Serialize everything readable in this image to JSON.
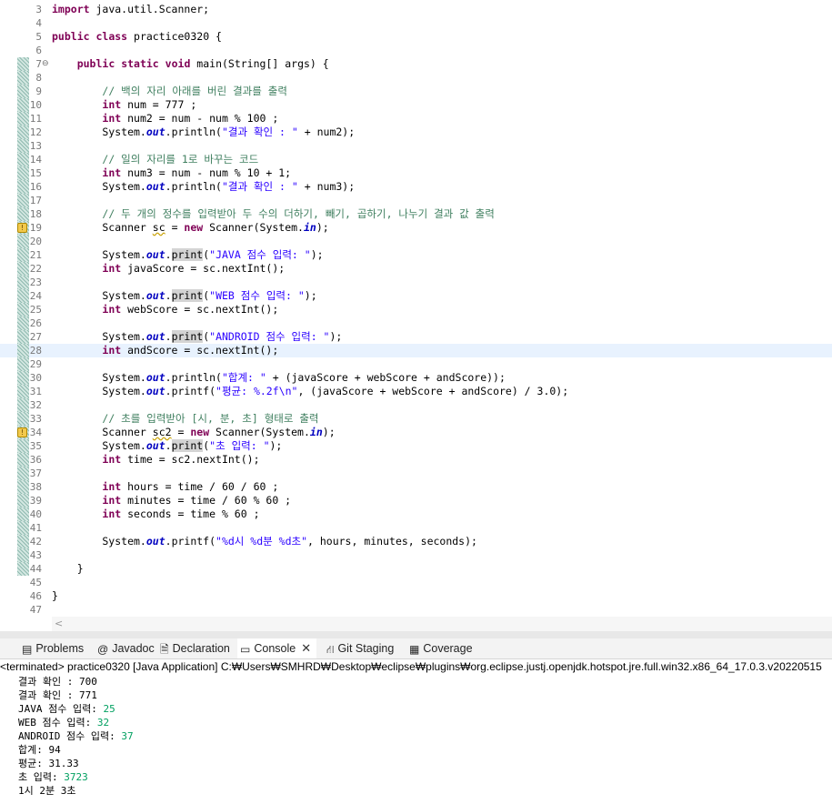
{
  "editor": {
    "lines": [
      {
        "n": "3",
        "segs": [
          {
            "c": "kw",
            "t": "import"
          },
          {
            "t": " java.util.Scanner;"
          }
        ]
      },
      {
        "n": "4",
        "segs": []
      },
      {
        "n": "5",
        "segs": [
          {
            "c": "kw",
            "t": "public"
          },
          {
            "t": " "
          },
          {
            "c": "kw",
            "t": "class"
          },
          {
            "t": " practice0320 {"
          }
        ]
      },
      {
        "n": "6",
        "segs": []
      },
      {
        "n": "7",
        "fold": "⊖",
        "ruler": true,
        "segs": [
          {
            "t": "    "
          },
          {
            "c": "kw",
            "t": "public"
          },
          {
            "t": " "
          },
          {
            "c": "kw",
            "t": "static"
          },
          {
            "t": " "
          },
          {
            "c": "kw",
            "t": "void"
          },
          {
            "t": " main(String[] args) {"
          }
        ]
      },
      {
        "n": "8",
        "ruler": true,
        "segs": []
      },
      {
        "n": "9",
        "ruler": true,
        "segs": [
          {
            "t": "        "
          },
          {
            "c": "cm",
            "t": "// 백의 자리 아래를 버린 결과를 출력"
          }
        ]
      },
      {
        "n": "10",
        "ruler": true,
        "segs": [
          {
            "t": "        "
          },
          {
            "c": "kw",
            "t": "int"
          },
          {
            "t": " num = 777 ;"
          }
        ]
      },
      {
        "n": "11",
        "ruler": true,
        "segs": [
          {
            "t": "        "
          },
          {
            "c": "kw",
            "t": "int"
          },
          {
            "t": " num2 = num - num % 100 ;"
          }
        ]
      },
      {
        "n": "12",
        "ruler": true,
        "segs": [
          {
            "t": "        System."
          },
          {
            "c": "fd",
            "t": "out"
          },
          {
            "t": ".println("
          },
          {
            "c": "st",
            "t": "\"결과 확인 : \""
          },
          {
            "t": " + num2);"
          }
        ]
      },
      {
        "n": "13",
        "ruler": true,
        "segs": []
      },
      {
        "n": "14",
        "ruler": true,
        "segs": [
          {
            "t": "        "
          },
          {
            "c": "cm",
            "t": "// 일의 자리를 1로 바꾸는 코드"
          }
        ]
      },
      {
        "n": "15",
        "ruler": true,
        "segs": [
          {
            "t": "        "
          },
          {
            "c": "kw",
            "t": "int"
          },
          {
            "t": " num3 = num - num % 10 + 1;"
          }
        ]
      },
      {
        "n": "16",
        "ruler": true,
        "segs": [
          {
            "t": "        System."
          },
          {
            "c": "fd",
            "t": "out"
          },
          {
            "t": ".println("
          },
          {
            "c": "st",
            "t": "\"결과 확인 : \""
          },
          {
            "t": " + num3);"
          }
        ]
      },
      {
        "n": "17",
        "ruler": true,
        "segs": []
      },
      {
        "n": "18",
        "ruler": true,
        "segs": [
          {
            "t": "        "
          },
          {
            "c": "cm",
            "t": "// 두 개의 정수를 입력받아 두 수의 더하기, 빼기, 곱하기, 나누기 결과 값 출력"
          }
        ]
      },
      {
        "n": "19",
        "ruler": true,
        "warn": true,
        "segs": [
          {
            "t": "        Scanner "
          },
          {
            "c": "squig",
            "t": "sc"
          },
          {
            "t": " = "
          },
          {
            "c": "kw",
            "t": "new"
          },
          {
            "t": " Scanner(System."
          },
          {
            "c": "fd",
            "t": "in"
          },
          {
            "t": ");"
          }
        ]
      },
      {
        "n": "20",
        "ruler": true,
        "segs": []
      },
      {
        "n": "21",
        "ruler": true,
        "segs": [
          {
            "t": "        System."
          },
          {
            "c": "fd",
            "t": "out"
          },
          {
            "t": "."
          },
          {
            "c": "mark",
            "t": "print"
          },
          {
            "t": "("
          },
          {
            "c": "st",
            "t": "\"JAVA 점수 입력: \""
          },
          {
            "t": ");"
          }
        ]
      },
      {
        "n": "22",
        "ruler": true,
        "segs": [
          {
            "t": "        "
          },
          {
            "c": "kw",
            "t": "int"
          },
          {
            "t": " javaScore = sc.nextInt();"
          }
        ]
      },
      {
        "n": "23",
        "ruler": true,
        "segs": []
      },
      {
        "n": "24",
        "ruler": true,
        "segs": [
          {
            "t": "        System."
          },
          {
            "c": "fd",
            "t": "out"
          },
          {
            "t": "."
          },
          {
            "c": "mark",
            "t": "print"
          },
          {
            "t": "("
          },
          {
            "c": "st",
            "t": "\"WEB 점수 입력: \""
          },
          {
            "t": ");"
          }
        ]
      },
      {
        "n": "25",
        "ruler": true,
        "segs": [
          {
            "t": "        "
          },
          {
            "c": "kw",
            "t": "int"
          },
          {
            "t": " webScore = sc.nextInt();"
          }
        ]
      },
      {
        "n": "26",
        "ruler": true,
        "segs": []
      },
      {
        "n": "27",
        "ruler": true,
        "segs": [
          {
            "t": "        System."
          },
          {
            "c": "fd",
            "t": "out"
          },
          {
            "t": "."
          },
          {
            "c": "mark",
            "t": "print"
          },
          {
            "t": "("
          },
          {
            "c": "st",
            "t": "\"ANDROID 점수 입력: \""
          },
          {
            "t": ");"
          }
        ]
      },
      {
        "n": "28",
        "ruler": true,
        "hl": true,
        "segs": [
          {
            "t": "        "
          },
          {
            "c": "kw",
            "t": "int"
          },
          {
            "t": " andScore = sc.nextInt();"
          }
        ]
      },
      {
        "n": "29",
        "ruler": true,
        "segs": []
      },
      {
        "n": "30",
        "ruler": true,
        "segs": [
          {
            "t": "        System."
          },
          {
            "c": "fd",
            "t": "out"
          },
          {
            "t": ".println("
          },
          {
            "c": "st",
            "t": "\"합계: \""
          },
          {
            "t": " + (javaScore + webScore + andScore));"
          }
        ]
      },
      {
        "n": "31",
        "ruler": true,
        "segs": [
          {
            "t": "        System."
          },
          {
            "c": "fd",
            "t": "out"
          },
          {
            "t": ".printf("
          },
          {
            "c": "st",
            "t": "\"평균: %.2f\\n\""
          },
          {
            "t": ", (javaScore + webScore + andScore) / 3.0);"
          }
        ]
      },
      {
        "n": "32",
        "ruler": true,
        "segs": []
      },
      {
        "n": "33",
        "ruler": true,
        "segs": [
          {
            "t": "        "
          },
          {
            "c": "cm",
            "t": "// 초를 입력받아 [시, 분, 초] 형태로 출력"
          }
        ]
      },
      {
        "n": "34",
        "ruler": true,
        "warn": true,
        "segs": [
          {
            "t": "        Scanner "
          },
          {
            "c": "squig",
            "t": "sc2"
          },
          {
            "t": " = "
          },
          {
            "c": "kw",
            "t": "new"
          },
          {
            "t": " Scanner(System."
          },
          {
            "c": "fd",
            "t": "in"
          },
          {
            "t": ");"
          }
        ]
      },
      {
        "n": "35",
        "ruler": true,
        "segs": [
          {
            "t": "        System."
          },
          {
            "c": "fd",
            "t": "out"
          },
          {
            "t": "."
          },
          {
            "c": "mark",
            "t": "print"
          },
          {
            "t": "("
          },
          {
            "c": "st",
            "t": "\"초 입력: \""
          },
          {
            "t": ");"
          }
        ]
      },
      {
        "n": "36",
        "ruler": true,
        "segs": [
          {
            "t": "        "
          },
          {
            "c": "kw",
            "t": "int"
          },
          {
            "t": " time = sc2.nextInt();"
          }
        ]
      },
      {
        "n": "37",
        "ruler": true,
        "segs": []
      },
      {
        "n": "38",
        "ruler": true,
        "segs": [
          {
            "t": "        "
          },
          {
            "c": "kw",
            "t": "int"
          },
          {
            "t": " hours = time / 60 / 60 ;"
          }
        ]
      },
      {
        "n": "39",
        "ruler": true,
        "segs": [
          {
            "t": "        "
          },
          {
            "c": "kw",
            "t": "int"
          },
          {
            "t": " minutes = time / 60 % 60 ;"
          }
        ]
      },
      {
        "n": "40",
        "ruler": true,
        "segs": [
          {
            "t": "        "
          },
          {
            "c": "kw",
            "t": "int"
          },
          {
            "t": " seconds = time % 60 ;"
          }
        ]
      },
      {
        "n": "41",
        "ruler": true,
        "segs": []
      },
      {
        "n": "42",
        "ruler": true,
        "segs": [
          {
            "t": "        System."
          },
          {
            "c": "fd",
            "t": "out"
          },
          {
            "t": ".printf("
          },
          {
            "c": "st",
            "t": "\"%d시 %d분 %d초\""
          },
          {
            "t": ", hours, minutes, seconds);"
          }
        ]
      },
      {
        "n": "43",
        "ruler": true,
        "segs": []
      },
      {
        "n": "44",
        "ruler": true,
        "segs": [
          {
            "t": "    }"
          }
        ]
      },
      {
        "n": "45",
        "segs": []
      },
      {
        "n": "46",
        "segs": [
          {
            "t": "}"
          }
        ]
      },
      {
        "n": "47",
        "segs": []
      }
    ]
  },
  "scroll": {
    "left_arrow": "<"
  },
  "tabs": [
    {
      "label": "Problems",
      "icon": "▤",
      "icon_name": "problems-icon"
    },
    {
      "label": "Javadoc",
      "icon": "@",
      "icon_name": "javadoc-icon"
    },
    {
      "label": "Declaration",
      "icon": "🗎",
      "icon_name": "declaration-icon"
    },
    {
      "label": "Console",
      "icon": "▭",
      "icon_name": "console-icon",
      "active": true,
      "close": "✕"
    },
    {
      "label": "Git Staging",
      "icon": "⛙",
      "icon_name": "git-staging-icon"
    },
    {
      "label": "Coverage",
      "icon": "▦",
      "icon_name": "coverage-icon"
    }
  ],
  "console": {
    "header": "<terminated> practice0320 [Java Application] C:₩Users₩SMHRD₩Desktop₩eclipse₩plugins₩org.eclipse.justj.openjdk.hotspot.jre.full.win32.x86_64_17.0.3.v20220515",
    "lines": [
      {
        "text": "결과 확인 : 700",
        "input": ""
      },
      {
        "text": "결과 확인 : 771",
        "input": ""
      },
      {
        "text": "JAVA 점수 입력: ",
        "input": "25"
      },
      {
        "text": "WEB 점수 입력: ",
        "input": "32"
      },
      {
        "text": "ANDROID 점수 입력: ",
        "input": "37"
      },
      {
        "text": "합계: 94",
        "input": ""
      },
      {
        "text": "평균: 31.33",
        "input": ""
      },
      {
        "text": "초 입력: ",
        "input": "3723"
      },
      {
        "text": "1시 2분 3초",
        "input": ""
      }
    ]
  },
  "colors": {
    "keyword": "#7f0055",
    "comment": "#3f7f5f",
    "string": "#2a00ff",
    "field": "#0000c0",
    "console_input": "#00a060"
  }
}
